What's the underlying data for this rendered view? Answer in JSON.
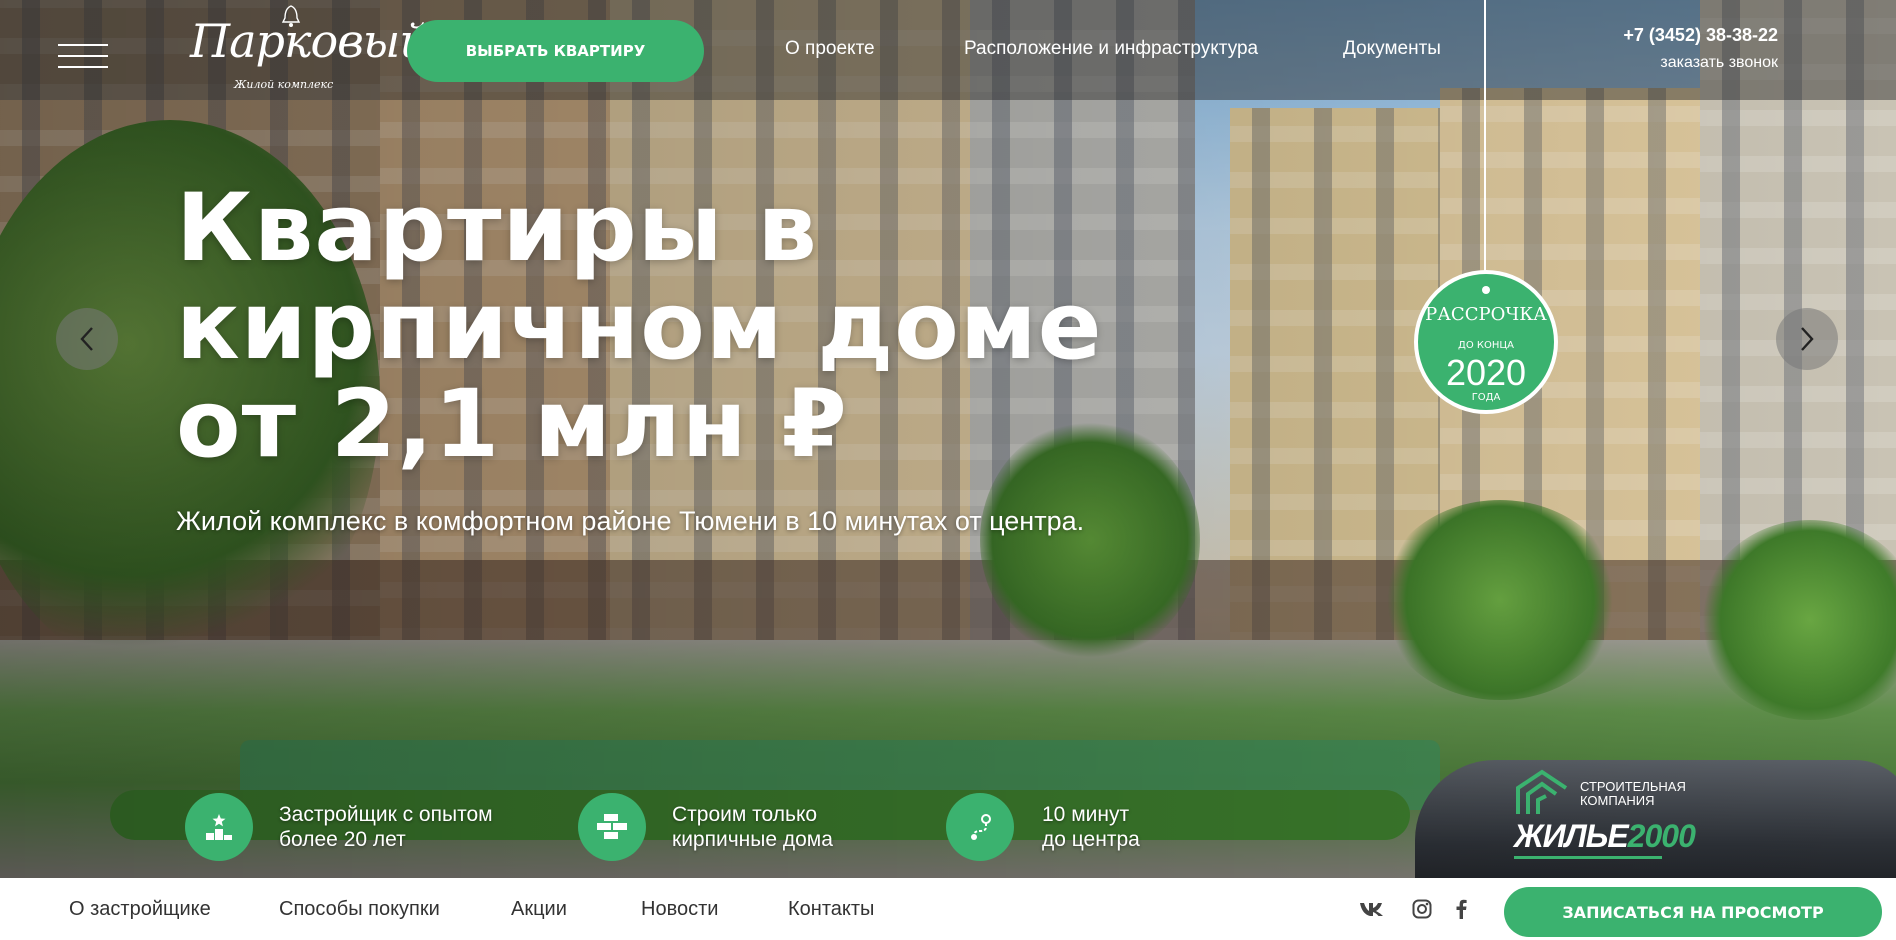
{
  "header": {
    "logo_title": "Парковый",
    "logo_subtitle": "Жилой комплекс",
    "choose_button": "ВЫБРАТЬ КВАРТИРУ",
    "nav": [
      "О проекте",
      "Расположение и инфраструктура",
      "Документы"
    ],
    "phone": "+7 (3452) 38-38-22",
    "callback": "заказать звонок"
  },
  "hero": {
    "headline_line1": "Квартиры в",
    "headline_line2": "кирпичном доме",
    "headline_line3": "от 2,1 млн ₽",
    "subtitle": "Жилой комплекс в комфортном районе Тюмени в 10 минутах от центра."
  },
  "badge": {
    "title": "РАССРОЧКА",
    "before": "ДО КОНЦА",
    "year": "2020",
    "after": "ГОДА"
  },
  "features": [
    {
      "line1": "Застройщик с опытом",
      "line2": "более 20 лет",
      "icon": "podium-icon"
    },
    {
      "line1": "Строим только",
      "line2": "кирпичные дома",
      "icon": "bricks-icon"
    },
    {
      "line1": "10 минут",
      "line2": "до центра",
      "icon": "route-icon"
    }
  ],
  "developer": {
    "line1": "СТРОИТЕЛЬНАЯ",
    "line2": "КОМПАНИЯ",
    "name_word": "ЖИЛЬЕ",
    "name_num": "2000"
  },
  "footer_nav": [
    "О застройщике",
    "Способы покупки",
    "Акции",
    "Новости",
    "Контакты"
  ],
  "social": [
    "vk-icon",
    "instagram-icon",
    "facebook-icon"
  ],
  "view_button": "ЗАПИСАТЬСЯ НА ПРОСМОТР",
  "colors": {
    "accent": "#3bb26f",
    "header_overlay": "rgba(40,40,40,0.45)",
    "footer_text": "#333333"
  }
}
